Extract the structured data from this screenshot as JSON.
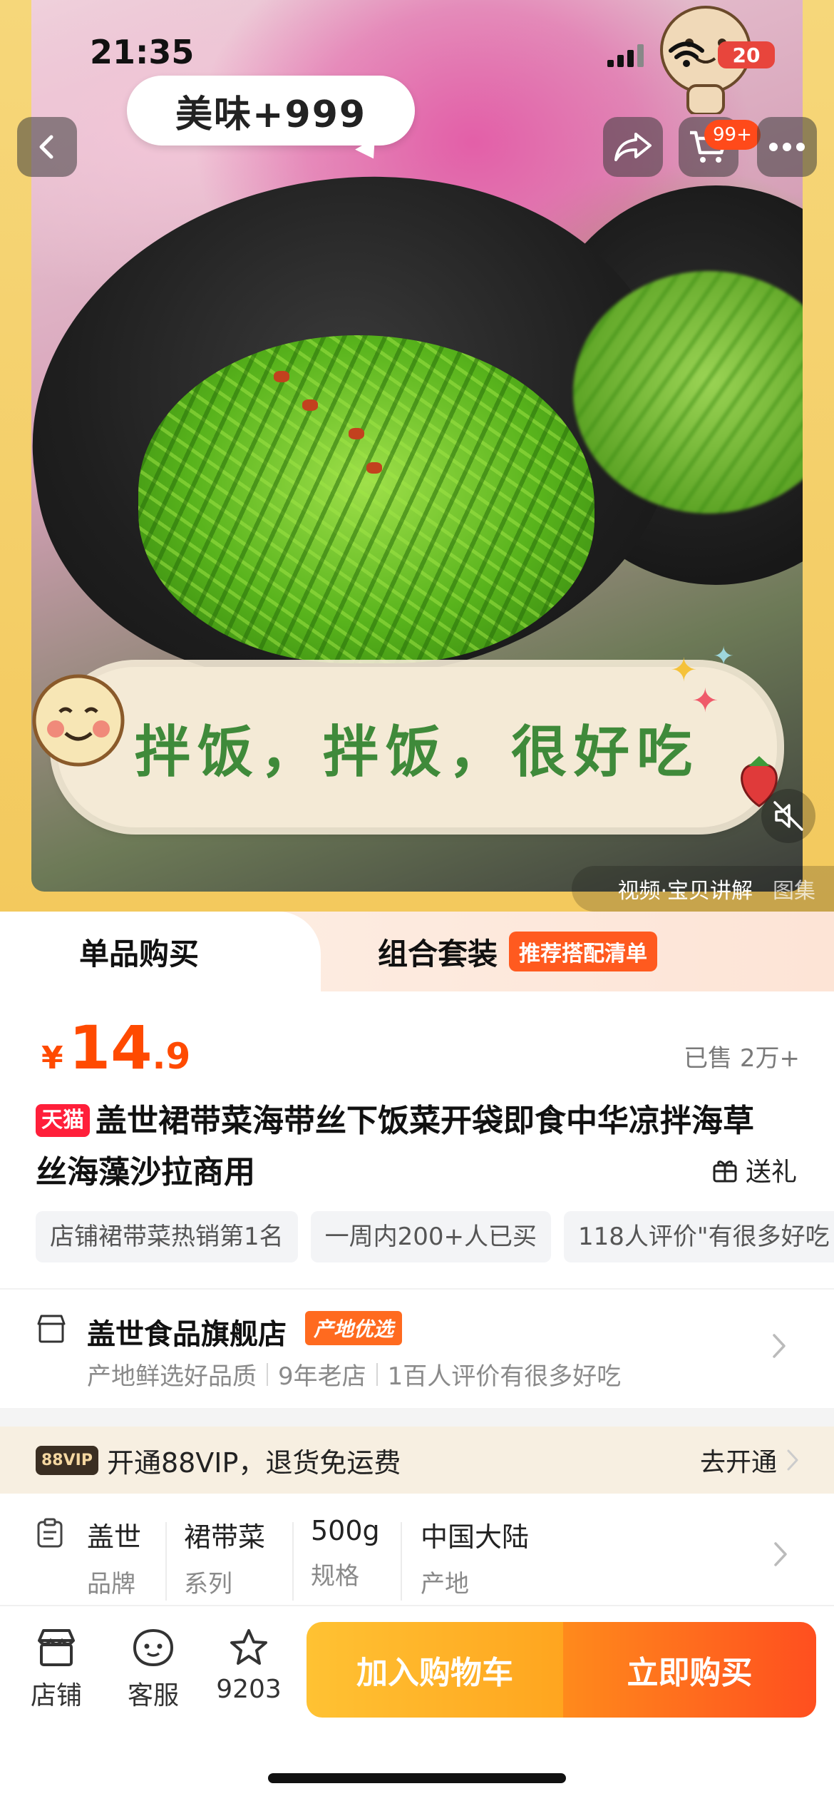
{
  "status_bar": {
    "time": "21:35",
    "battery": "20"
  },
  "media": {
    "speech_bubble": "美味+999",
    "overlay_caption": "拌饭，拌饭，很好吃",
    "tabs": [
      "视频·宝贝讲解",
      "图集"
    ],
    "cart_badge": "99+"
  },
  "purchase_tabs": {
    "single": "单品购买",
    "combo": "组合套装",
    "combo_tag": "推荐搭配清单"
  },
  "price": {
    "currency": "¥",
    "integer": "14",
    "decimal": ".9"
  },
  "sold": "已售 2万+",
  "product": {
    "platform_tag": "天猫",
    "title": "盖世裙带菜海带丝下饭菜开袋即食中华凉拌海草丝海藻沙拉商用",
    "gift_label": "送礼"
  },
  "pills": [
    "店铺裙带菜热销第1名",
    "一周内200+人已买",
    "118人评价\"有很多好吃"
  ],
  "store": {
    "name": "盖世食品旗舰店",
    "tag": "产地优选",
    "features": [
      "产地鲜选好品质",
      "9年老店",
      "1百人评价有很多好吃"
    ]
  },
  "vip": {
    "badge": "88VIP",
    "text": "开通88VIP，退货免运费",
    "cta": "去开通"
  },
  "specs": [
    {
      "value": "盖世",
      "key": "品牌"
    },
    {
      "value": "裙带菜",
      "key": "系列"
    },
    {
      "value": "500g",
      "key": "规格"
    },
    {
      "value": "中国大陆",
      "key": "产地"
    }
  ],
  "bottom_bar": {
    "store": "店铺",
    "service": "客服",
    "favorites_count": "9203",
    "add_to_cart": "加入购物车",
    "buy_now": "立即购买"
  },
  "colors": {
    "accent": "#ff4a00",
    "tmall": "#ff1f3a",
    "cart_button": "#ffb128",
    "buy_button": "#ff5a1f"
  }
}
